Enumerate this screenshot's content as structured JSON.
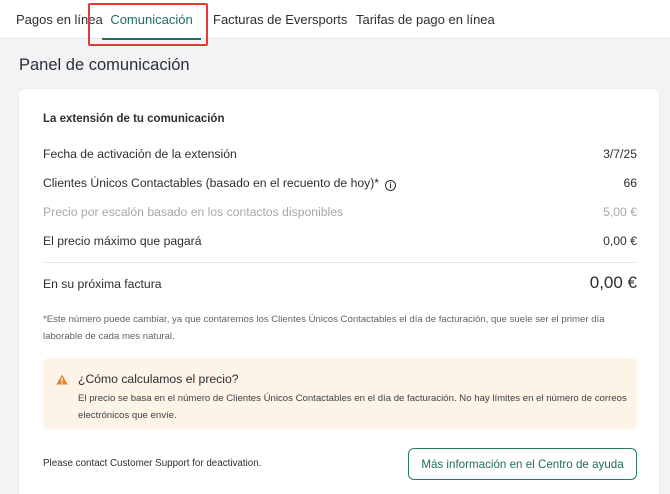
{
  "tabs": [
    {
      "label": "Pagos en línea"
    },
    {
      "label": "Comunicación"
    },
    {
      "label": "Facturas de Eversports"
    },
    {
      "label": "Tarifas de pago en línea"
    }
  ],
  "active_tab": "Comunicación",
  "page_title": "Panel de comunicación",
  "section_title": "La extensión de tu comunicación",
  "rows": [
    {
      "label": "Fecha de activación de la extensión",
      "value": "3/7/25"
    },
    {
      "label": "Clientes Únicos Contactables (basado en el recuento de hoy)*",
      "value": "66"
    },
    {
      "label": "Precio por escalón basado en los contactos disponibles",
      "value": "5,00 €"
    },
    {
      "label": "El precio máximo que pagará",
      "value": "0,00 €"
    }
  ],
  "total": {
    "label": "En su próxima factura",
    "value": "0,00 €"
  },
  "footnote": "*Este número puede cambiar, ya que contaremos los Clientes Únicos Contactables el día de facturación, que suele ser el primer día laborable de cada mes natural.",
  "alert": {
    "title": "¿Cómo calculamos el precio?",
    "text": "El precio se basa en el número de Clientes Únicos Contactables en el día de facturación. No hay límites en el número de correos electrónicos que envíe."
  },
  "contact_text": "Please contact Customer Support for deactivation.",
  "help_button": "Más información en el Centro de ayuda",
  "colors": {
    "accent": "#1f6e5e",
    "highlight_box": "#e53935",
    "alert_background": "#fdf3e6",
    "warning_icon": "#e8812a"
  },
  "icons": {
    "info": "info-icon",
    "warning": "warning-icon"
  }
}
